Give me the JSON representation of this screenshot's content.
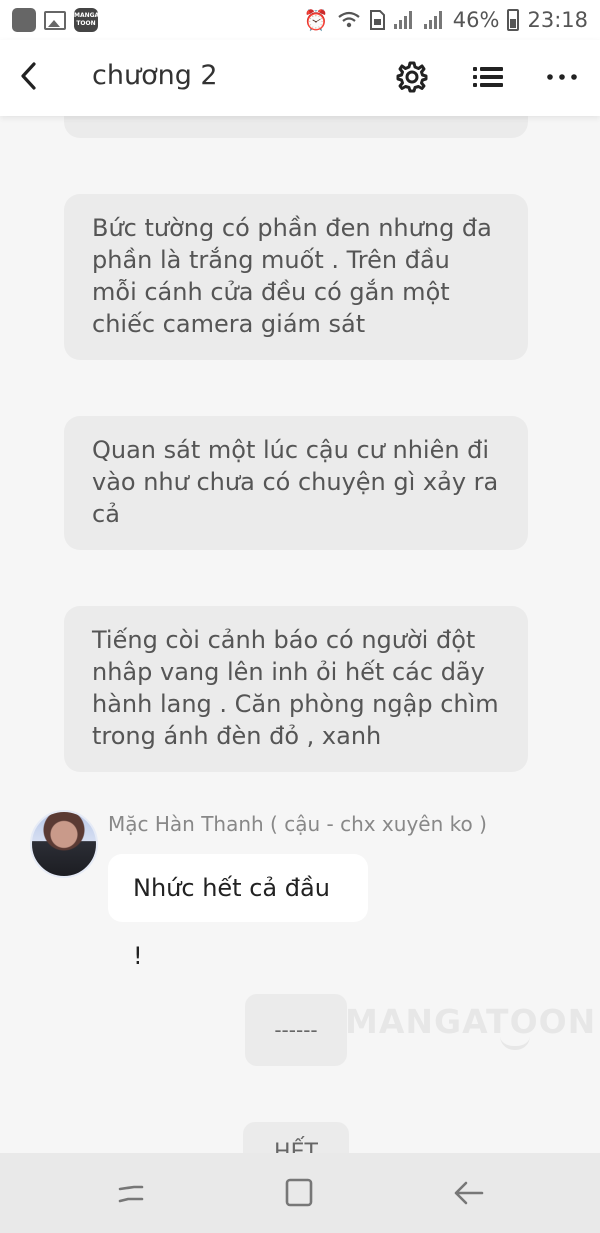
{
  "status_bar": {
    "logo_text": "MANGA TOON",
    "battery": "46%",
    "time": "23:18"
  },
  "header": {
    "title": "chương 2"
  },
  "messages": {
    "narration_1": "Bức tường có phần đen nhưng đa phần là trắng muốt . Trên đầu mỗi cánh cửa đều có gắn một chiếc camera giám sát",
    "narration_2": "Quan sát một lúc cậu cư nhiên đi vào như chưa có chuyện gì xảy ra cả",
    "narration_3": "Tiếng còi cảnh báo có người đột nhâp vang lên inh ỏi hết các dãy hành lang . Căn phòng ngập chìm trong ánh đèn đỏ , xanh",
    "speaker": "Mặc Hàn Thanh ( cậu - chx xuyên ko )",
    "speech": "Nhức hết cả đầu !",
    "divider": "------",
    "partial_next": "HẾT"
  },
  "watermark": "MANGATOON",
  "icons": {
    "back": "chevron-left-icon",
    "settings": "gear-icon",
    "list": "list-icon",
    "more": "more-dots-icon"
  }
}
